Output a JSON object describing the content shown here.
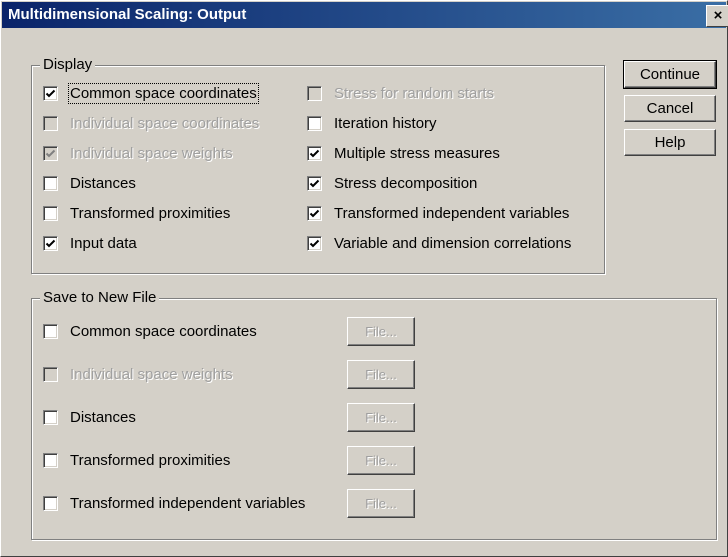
{
  "window": {
    "title": "Multidimensional Scaling: Output",
    "close_label": "×"
  },
  "display": {
    "legend": "Display",
    "left": [
      {
        "label": "Common space coordinates",
        "checked": true,
        "enabled": true,
        "focused": true
      },
      {
        "label": "Individual space coordinates",
        "checked": false,
        "enabled": false
      },
      {
        "label": "Individual space weights",
        "checked": true,
        "enabled": false
      },
      {
        "label": "Distances",
        "checked": false,
        "enabled": true
      },
      {
        "label": "Transformed proximities",
        "checked": false,
        "enabled": true
      },
      {
        "label": "Input data",
        "checked": true,
        "enabled": true
      }
    ],
    "right": [
      {
        "label": "Stress for random starts",
        "checked": false,
        "enabled": false
      },
      {
        "label": "Iteration history",
        "checked": false,
        "enabled": true
      },
      {
        "label": "Multiple stress measures",
        "checked": true,
        "enabled": true
      },
      {
        "label": "Stress decomposition",
        "checked": true,
        "enabled": true
      },
      {
        "label": "Transformed independent variables",
        "checked": true,
        "enabled": true
      },
      {
        "label": "Variable and dimension correlations",
        "checked": true,
        "enabled": true
      }
    ]
  },
  "save": {
    "legend": "Save to New File",
    "items": [
      {
        "label": "Common space coordinates",
        "checked": false,
        "enabled": true,
        "file_label": "File..."
      },
      {
        "label": "Individual space weights",
        "checked": false,
        "enabled": false,
        "file_label": "File..."
      },
      {
        "label": "Distances",
        "checked": false,
        "enabled": true,
        "file_label": "File..."
      },
      {
        "label": "Transformed proximities",
        "checked": false,
        "enabled": true,
        "file_label": "File..."
      },
      {
        "label": "Transformed independent variables",
        "checked": false,
        "enabled": true,
        "file_label": "File..."
      }
    ]
  },
  "buttons": {
    "continue": "Continue",
    "cancel": "Cancel",
    "help": "Help"
  }
}
